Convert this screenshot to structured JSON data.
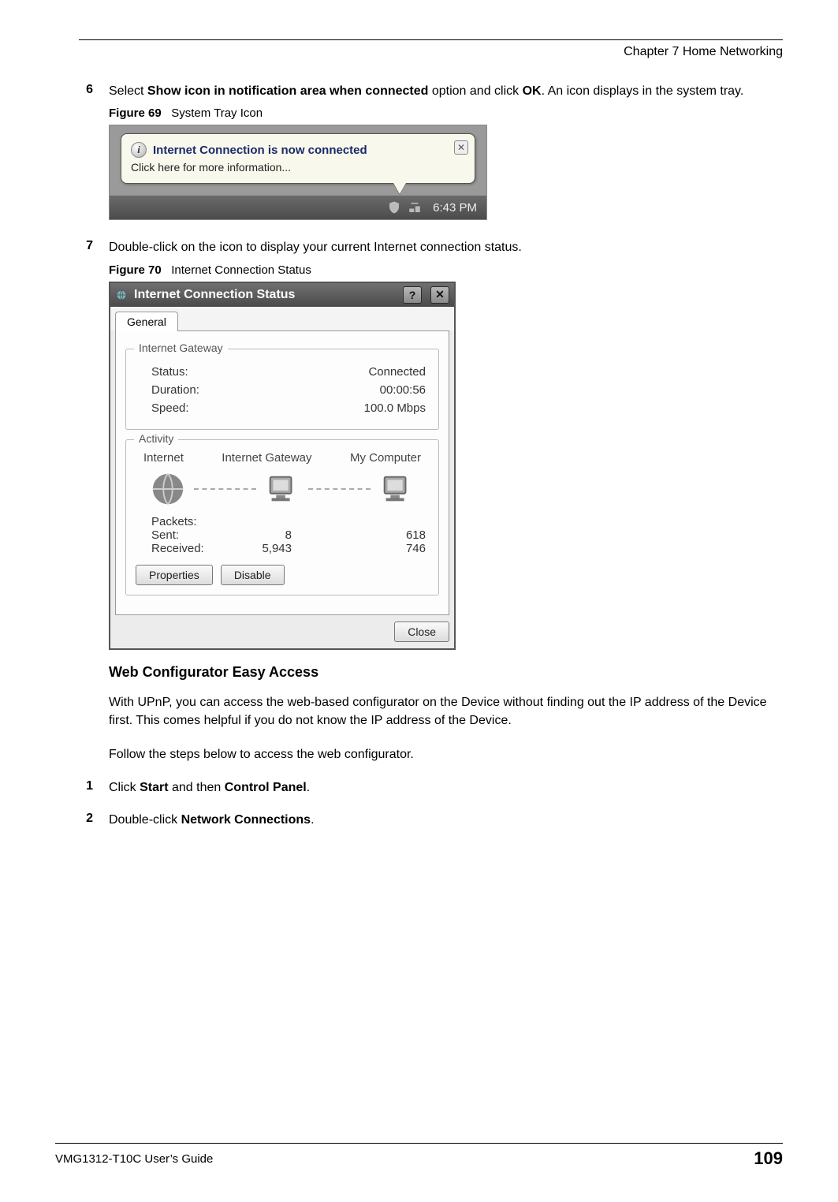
{
  "header": {
    "chapter": "Chapter 7 Home Networking"
  },
  "steps": {
    "s6_num": "6",
    "s6_text_pre": "Select ",
    "s6_bold1": "Show icon in notification area when connected",
    "s6_text_mid": " option and click ",
    "s6_bold2": "OK",
    "s6_text_post": ". An icon displays in the system tray.",
    "s7_num": "7",
    "s7_text": "Double-click on the icon to display your current Internet connection status.",
    "s1_num": "1",
    "s1_pre": "Click ",
    "s1_b1": "Start",
    "s1_mid": " and then ",
    "s1_b2": "Control Panel",
    "s1_post": ".",
    "s2_num": "2",
    "s2_pre": "Double-click ",
    "s2_b1": "Network Connections",
    "s2_post": "."
  },
  "fig69": {
    "caption_label": "Figure 69",
    "caption_text": "System Tray Icon",
    "balloon_title": "Internet Connection is now connected",
    "balloon_sub": "Click here for more information...",
    "balloon_close": "✕",
    "tray_time": "6:43 PM"
  },
  "fig70": {
    "caption_label": "Figure 70",
    "caption_text": "Internet Connection Status",
    "window_title": "Internet Connection Status",
    "help_btn": "?",
    "close_btn": "✕",
    "tab_general": "General",
    "group_gateway": {
      "legend": "Internet Gateway",
      "status_label": "Status:",
      "status_value": "Connected",
      "duration_label": "Duration:",
      "duration_value": "00:00:56",
      "speed_label": "Speed:",
      "speed_value": "100.0 Mbps"
    },
    "group_activity": {
      "legend": "Activity",
      "col_internet": "Internet",
      "col_gateway": "Internet Gateway",
      "col_computer": "My Computer",
      "packets_label": "Packets:",
      "sent_label": "Sent:",
      "sent_a": "8",
      "sent_b": "618",
      "recv_label": "Received:",
      "recv_a": "5,943",
      "recv_b": "746"
    },
    "btn_properties": "Properties",
    "btn_disable": "Disable",
    "btn_close": "Close"
  },
  "section": {
    "heading": "Web Configurator Easy Access",
    "para1": "With UPnP, you can access the web-based configurator on the Device without finding out the IP address of the Device first. This comes helpful if you do not know the IP address of the Device.",
    "para2": "Follow the steps below to access the web configurator."
  },
  "footer": {
    "guide": "VMG1312-T10C User’s Guide",
    "page": "109"
  }
}
